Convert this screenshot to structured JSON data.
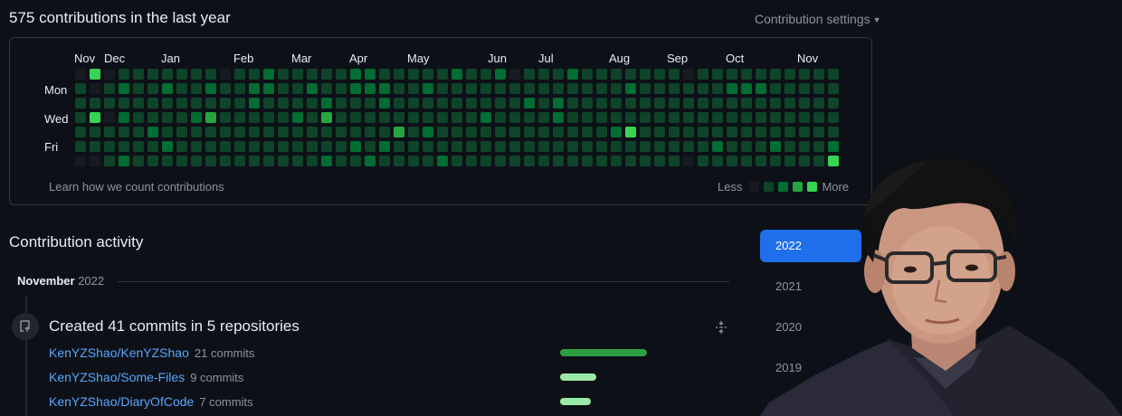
{
  "header": {
    "contributions_summary": "575 contributions in the last year",
    "settings_label": "Contribution settings"
  },
  "calendar": {
    "months": [
      "Nov",
      "Dec",
      "Jan",
      "Feb",
      "Mar",
      "Apr",
      "May",
      "Jun",
      "Jul",
      "Aug",
      "Sep",
      "Oct",
      "Nov"
    ],
    "days": [
      "Mon",
      "Wed",
      "Fri"
    ],
    "learn_link": "Learn how we count contributions",
    "legend_less": "Less",
    "legend_more": "More",
    "level_colors": [
      "#161b22",
      "#0e4429",
      "#006d32",
      "#26a641",
      "#39d353"
    ],
    "week_levels": [
      [
        0,
        1,
        1,
        1,
        1,
        1,
        0
      ],
      [
        4,
        0,
        1,
        4,
        1,
        1,
        0
      ],
      [
        0,
        1,
        1,
        0,
        1,
        1,
        1
      ],
      [
        1,
        2,
        1,
        2,
        1,
        1,
        2
      ],
      [
        1,
        1,
        1,
        1,
        1,
        1,
        1
      ],
      [
        1,
        1,
        1,
        1,
        2,
        1,
        1
      ],
      [
        1,
        2,
        1,
        1,
        1,
        2,
        1
      ],
      [
        1,
        1,
        1,
        1,
        1,
        1,
        1
      ],
      [
        1,
        1,
        1,
        2,
        1,
        1,
        1
      ],
      [
        1,
        2,
        1,
        3,
        1,
        1,
        1
      ],
      [
        0,
        1,
        1,
        1,
        1,
        1,
        1
      ],
      [
        1,
        1,
        1,
        1,
        1,
        1,
        1
      ],
      [
        1,
        2,
        2,
        1,
        1,
        1,
        1
      ],
      [
        2,
        2,
        1,
        1,
        1,
        1,
        1
      ],
      [
        1,
        1,
        1,
        1,
        1,
        1,
        1
      ],
      [
        1,
        1,
        1,
        2,
        1,
        1,
        1
      ],
      [
        1,
        2,
        1,
        1,
        1,
        1,
        1
      ],
      [
        1,
        1,
        2,
        3,
        1,
        1,
        2
      ],
      [
        1,
        1,
        1,
        1,
        1,
        1,
        1
      ],
      [
        2,
        2,
        1,
        1,
        1,
        2,
        1
      ],
      [
        2,
        2,
        1,
        1,
        1,
        1,
        2
      ],
      [
        1,
        2,
        2,
        1,
        1,
        2,
        1
      ],
      [
        1,
        1,
        1,
        1,
        3,
        1,
        1
      ],
      [
        1,
        1,
        1,
        1,
        1,
        1,
        1
      ],
      [
        1,
        2,
        1,
        1,
        2,
        1,
        1
      ],
      [
        1,
        1,
        1,
        1,
        1,
        1,
        2
      ],
      [
        2,
        1,
        1,
        1,
        1,
        1,
        1
      ],
      [
        1,
        1,
        1,
        1,
        1,
        1,
        1
      ],
      [
        1,
        1,
        1,
        2,
        1,
        1,
        1
      ],
      [
        2,
        1,
        1,
        1,
        1,
        1,
        1
      ],
      [
        0,
        1,
        1,
        1,
        1,
        1,
        1
      ],
      [
        1,
        1,
        2,
        1,
        1,
        1,
        1
      ],
      [
        1,
        1,
        1,
        1,
        1,
        1,
        1
      ],
      [
        1,
        1,
        2,
        2,
        1,
        1,
        1
      ],
      [
        2,
        1,
        1,
        1,
        1,
        1,
        1
      ],
      [
        1,
        1,
        1,
        1,
        1,
        1,
        1
      ],
      [
        1,
        1,
        1,
        1,
        1,
        1,
        1
      ],
      [
        1,
        1,
        1,
        1,
        2,
        1,
        1
      ],
      [
        1,
        2,
        1,
        1,
        4,
        1,
        1
      ],
      [
        1,
        1,
        1,
        1,
        1,
        1,
        1
      ],
      [
        1,
        1,
        1,
        1,
        1,
        1,
        1
      ],
      [
        1,
        1,
        1,
        1,
        1,
        1,
        1
      ],
      [
        0,
        1,
        1,
        1,
        1,
        1,
        0
      ],
      [
        1,
        1,
        1,
        1,
        1,
        1,
        1
      ],
      [
        1,
        1,
        1,
        1,
        1,
        2,
        1
      ],
      [
        1,
        2,
        1,
        1,
        1,
        1,
        1
      ],
      [
        1,
        2,
        1,
        1,
        1,
        1,
        1
      ],
      [
        1,
        2,
        1,
        1,
        1,
        1,
        1
      ],
      [
        1,
        1,
        1,
        1,
        1,
        2,
        1
      ],
      [
        1,
        1,
        1,
        1,
        1,
        1,
        1
      ],
      [
        1,
        1,
        1,
        1,
        1,
        1,
        1
      ],
      [
        1,
        1,
        1,
        1,
        1,
        1,
        1
      ],
      [
        1,
        1,
        1,
        1,
        1,
        2,
        4
      ]
    ]
  },
  "activity": {
    "title": "Contribution activity",
    "month": "November",
    "year": "2022",
    "event_title": "Created 41 commits in 5 repositories",
    "repos": [
      {
        "name": "KenYZShao/KenYZShao",
        "commits": "21 commits",
        "bar_fraction": 0.48,
        "bar_color": "#2ea043"
      },
      {
        "name": "KenYZShao/Some-Files",
        "commits": "9 commits",
        "bar_fraction": 0.2,
        "bar_color": "#9be9a8"
      },
      {
        "name": "KenYZShao/DiaryOfCode",
        "commits": "7 commits",
        "bar_fraction": 0.17,
        "bar_color": "#9be9a8"
      }
    ]
  },
  "years": [
    "2022",
    "2021",
    "2020",
    "2019"
  ],
  "active_year": "2022",
  "icons": [
    "caret-down-icon",
    "repo-push-icon",
    "collapse-icon"
  ]
}
